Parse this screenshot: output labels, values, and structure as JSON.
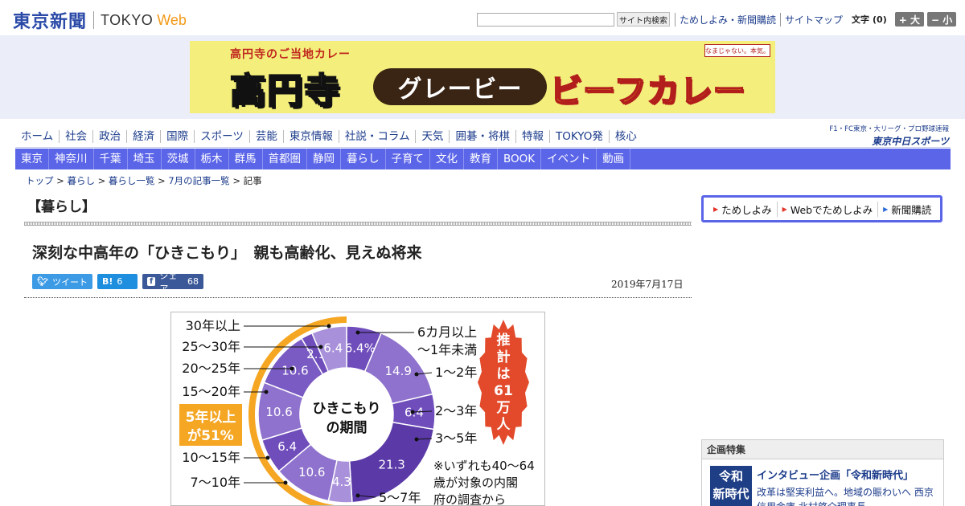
{
  "header": {
    "logo_jp": "東京新聞",
    "logo_en": "TOKYO",
    "logo_web": "Web",
    "search_button": "サイト内検索",
    "util_links": [
      "ためしよみ・新聞購読",
      "サイトマップ"
    ],
    "font_label": "文字",
    "font_count": "(0)",
    "font_bigger": "+ 大",
    "font_smaller": "− 小"
  },
  "banner": {
    "sub": "高円寺のご当地カレー",
    "main": "高円寺",
    "pill": "グレービー",
    "right": "ビーフカレー",
    "stamp": "なまじゃない。本気。"
  },
  "nav_primary": [
    "ホーム",
    "社会",
    "政治",
    "経済",
    "国際",
    "スポーツ",
    "芸能",
    "東京情報",
    "社説・コラム",
    "天気",
    "囲碁・将棋",
    "特報",
    "TOKYO発",
    "核心"
  ],
  "nav_right": {
    "top": "F1・FC東京・大リーグ・プロ野球速報",
    "bottom": "東京中日スポーツ"
  },
  "nav_secondary": [
    "東京",
    "神奈川",
    "千葉",
    "埼玉",
    "茨城",
    "栃木",
    "群馬",
    "首都圏",
    "静岡",
    "暮らし",
    "子育て",
    "文化",
    "教育",
    "BOOK",
    "イベント",
    "動画"
  ],
  "breadcrumb": {
    "items": [
      "トップ",
      "暮らし",
      "暮らし一覧",
      "7月の記事一覧"
    ],
    "current": "記事",
    "sep": " > "
  },
  "section_title": "【暮らし】",
  "article": {
    "headline": "深刻な中高年の「ひきこもり」　親も高齢化、見えぬ将来",
    "date": "2019年7月17日",
    "share": {
      "tweet_label": "ツイート",
      "hatena_icon": "B!",
      "hatena_count": "6",
      "fb_icon": "f",
      "fb_label": "シェア",
      "fb_count": "68"
    }
  },
  "figure": {
    "center_line1": "ひきこもり",
    "center_line2": "の期間",
    "badge_line1": "5年以上",
    "badge_line2": "が51%",
    "burst_text": [
      "推",
      "計",
      "は",
      "61",
      "万",
      "人"
    ],
    "note_lines": [
      "※いずれも40〜64",
      "歳が対象の内閣",
      "府の調査から"
    ],
    "segments": [
      {
        "label": "6カ月以上〜1年未満",
        "value": 6.4,
        "display": "6.4%",
        "color": "#6f4dbb"
      },
      {
        "label": "1〜2年",
        "value": 14.9,
        "display": "14.9",
        "color": "#8f72cd"
      },
      {
        "label": "2〜3年",
        "value": 6.4,
        "display": "6.4",
        "color": "#6f4dbb"
      },
      {
        "label": "3〜5年",
        "value": 21.3,
        "display": "21.3",
        "color": "#5b3aa8"
      },
      {
        "label": "5〜7年",
        "value": 4.3,
        "display": "4.3",
        "color": "#a891da"
      },
      {
        "label": "7〜10年",
        "value": 10.6,
        "display": "10.6",
        "color": "#8f72cd"
      },
      {
        "label": "10〜15年",
        "value": 6.4,
        "display": "6.4",
        "color": "#6f4dbb"
      },
      {
        "label": "15〜20年",
        "value": 10.6,
        "display": "10.6",
        "color": "#8f72cd"
      },
      {
        "label": "20〜25年",
        "value": 10.6,
        "display": "10.6",
        "color": "#7a5bc3"
      },
      {
        "label": "25〜30年",
        "value": 2.1,
        "display": "2.1",
        "color": "#6f4dbb"
      },
      {
        "label": "30年以上",
        "value": 6.4,
        "display": "6.4",
        "color": "#a891da"
      }
    ],
    "label_order_left": [
      "30年以上",
      "25〜30年",
      "20〜25年",
      "15〜20年",
      "10〜15年",
      "7〜10年"
    ],
    "label_order_right": [
      "6カ月以上",
      "〜1年未満",
      "1〜2年",
      "2〜3年",
      "3〜5年",
      "5〜7年"
    ]
  },
  "sidebar": {
    "links": [
      "ためしよみ",
      "Webでためしよみ",
      "新聞購読"
    ],
    "feature_head": "企画特集",
    "feature_thumb": [
      "令和",
      "新時代"
    ],
    "feature_title": "インタビュー企画「令和新時代」",
    "feature_body": "改革は堅実利益へ。地域の賑わいへ 西京信用金庫 北村啓介理事長"
  },
  "colors": {
    "nav_blue": "#5b65e8",
    "link_blue": "#1b3b8b",
    "logo_blue": "#2b4aa8",
    "accent_orange": "#f39a17",
    "badge_orange": "#f5a623",
    "burst_red": "#e24a2b"
  }
}
